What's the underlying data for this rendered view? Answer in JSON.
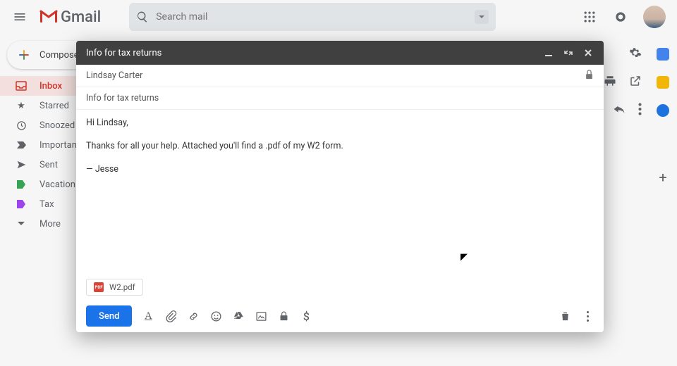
{
  "header": {
    "app_name": "Gmail",
    "search_placeholder": "Search mail"
  },
  "sidebar": {
    "compose_label": "Compose",
    "items": [
      {
        "label": "Inbox"
      },
      {
        "label": "Starred"
      },
      {
        "label": "Snoozed"
      },
      {
        "label": "Important"
      },
      {
        "label": "Sent"
      },
      {
        "label": "Vacation"
      },
      {
        "label": "Tax"
      },
      {
        "label": "More"
      }
    ]
  },
  "compose_dialog": {
    "title": "Info for tax returns",
    "to": "Lindsay Carter",
    "subject": "Info for tax returns",
    "body_lines": [
      "Hi Lindsay,",
      "Thanks for all your help. Attached you'll find a .pdf of my W2 form.",
      "— Jesse"
    ],
    "attachment": {
      "name": "W2.pdf",
      "badge": "PDF"
    },
    "send_label": "Send"
  },
  "colors": {
    "accent": "#1a73e8",
    "danger": "#d93025",
    "muted": "#5f6368"
  }
}
